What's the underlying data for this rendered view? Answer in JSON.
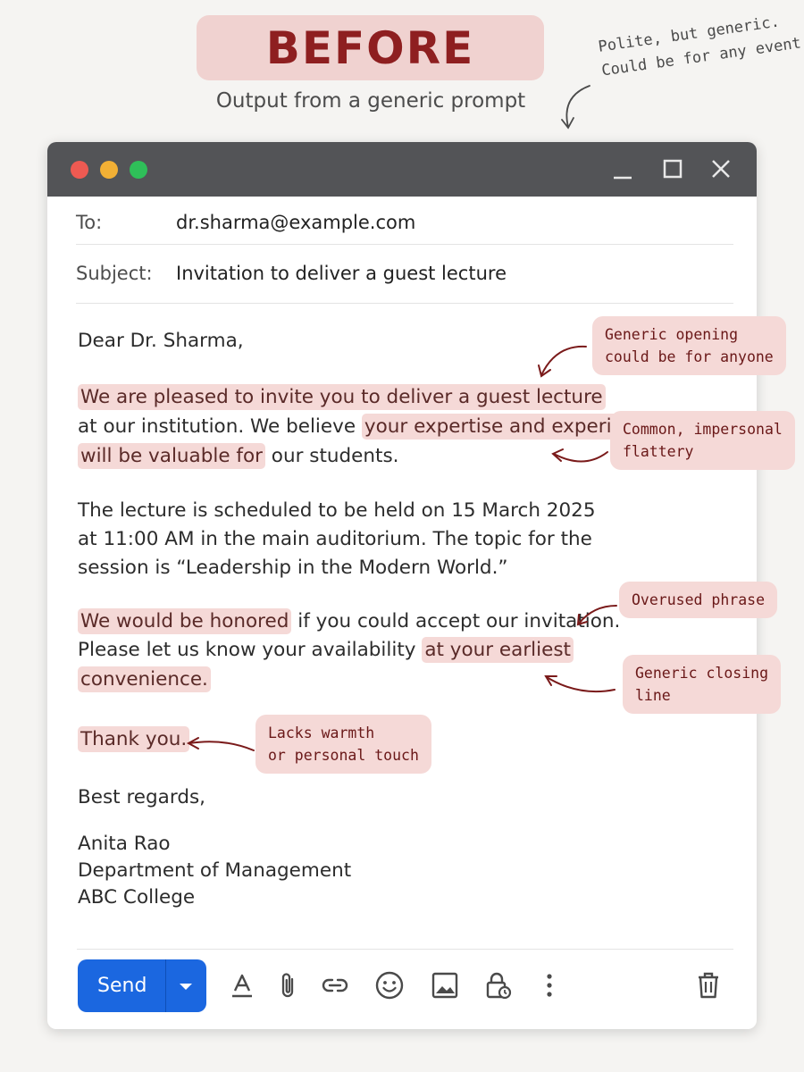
{
  "header": {
    "badge": "BEFORE",
    "subtitle": "Output from a generic prompt",
    "note_line1": "Polite, but generic.",
    "note_line2": "Could be for any event."
  },
  "window": {
    "icons": [
      "minimize-icon",
      "maximize-icon",
      "close-icon"
    ]
  },
  "email": {
    "to_label": "To:",
    "to_value": "dr.sharma@example.com",
    "subject_label": "Subject:",
    "subject_value": "Invitation to deliver a guest lecture",
    "greeting": "Dear Dr. Sharma,",
    "p1_l1": "We are pleased to invite you to deliver a guest lecture",
    "p1_l2a": "at our institution. We believe ",
    "p1_l2b": "your expertise and experience",
    "p1_l3a": "will be valuable for",
    "p1_l3b": " our students.",
    "p2_l1": "The lecture is scheduled to be held on 15 March 2025",
    "p2_l2": "at 11:00 AM in the main auditorium. The topic for the",
    "p2_l3": "session is “Leadership in the Modern World.”",
    "p3_l1a": "We would be honored",
    "p3_l1b": " if you could accept our invitation.",
    "p3_l2a": "Please let us know your availability ",
    "p3_l2b": "at your earliest",
    "p3_l3": "convenience.",
    "thanks": "Thank you.",
    "signoff": "Best regards,",
    "sig_name": "Anita Rao",
    "sig_dept": "Department of Management",
    "sig_org": "ABC College"
  },
  "annotations": {
    "a1_l1": "Generic opening",
    "a1_l2": "could be for anyone",
    "a2_l1": "Common, impersonal",
    "a2_l2": "flattery",
    "a3_l1": "Overused phrase",
    "a4_l1": "Generic closing",
    "a4_l2": "line",
    "a5_l1": "Lacks warmth",
    "a5_l2": "or personal touch"
  },
  "toolbar": {
    "send_label": "Send",
    "icons": [
      "send-options-caret-icon",
      "text-format-icon",
      "attach-icon",
      "link-icon",
      "emoji-icon",
      "image-icon",
      "confidential-lock-icon",
      "more-options-icon",
      "delete-icon"
    ]
  },
  "colors": {
    "highlight": "#f5d9d7",
    "badge_text": "#8e1f20",
    "annotation_text": "#6a1818",
    "send_button": "#1b67e0",
    "titlebar": "#535457"
  }
}
